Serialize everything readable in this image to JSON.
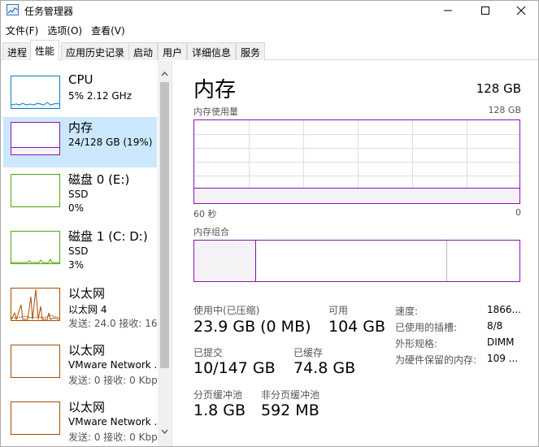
{
  "window": {
    "title": "任务管理器",
    "minimize_glyph": "—",
    "maximize_glyph": "☐",
    "close_glyph": "✕"
  },
  "menu": [
    {
      "label": "文件(F)"
    },
    {
      "label": "选项(O)"
    },
    {
      "label": "查看(V)"
    }
  ],
  "tabs": [
    {
      "label": "进程"
    },
    {
      "label": "性能"
    },
    {
      "label": "应用历史记录"
    },
    {
      "label": "启动"
    },
    {
      "label": "用户"
    },
    {
      "label": "详细信息"
    },
    {
      "label": "服务"
    }
  ],
  "active_tab": "性能",
  "sidebar": {
    "items": [
      {
        "title": "CPU",
        "line1": "5% 2.12 GHz",
        "line2": "",
        "line3": ""
      },
      {
        "title": "内存",
        "line1": "24/128 GB (19%)",
        "line2": "",
        "line3": ""
      },
      {
        "title": "磁盘 0 (E:)",
        "line1": "SSD",
        "line2": "0%",
        "line3": ""
      },
      {
        "title": "磁盘 1 (C: D:)",
        "line1": "SSD",
        "line2": "3%",
        "line3": ""
      },
      {
        "title": "以太网",
        "line1": "以太网 4",
        "line2": "发送: 24.0  接收: 16.",
        "line3": ""
      },
      {
        "title": "以太网",
        "line1": "VMware Network ...",
        "line2": "发送: 0  接收: 0 Kbp",
        "line3": ""
      },
      {
        "title": "以太网",
        "line1": "VMware Network ...",
        "line2": "发送: 0  接收: 0 Kbp",
        "line3": ""
      }
    ]
  },
  "memory": {
    "title": "内存",
    "total": "128 GB",
    "usage_label": "内存使用量",
    "usage_max": "128 GB",
    "usage_fraction": 0.19,
    "axis_left": "60 秒",
    "axis_right": "0",
    "composition_label": "内存组合",
    "stats": {
      "in_use_label": "使用中(已压缩)",
      "in_use_value": "23.9 GB (0 MB)",
      "available_label": "可用",
      "available_value": "104 GB",
      "committed_label": "已提交",
      "committed_value": "10/147 GB",
      "cached_label": "已缓存",
      "cached_value": "74.8 GB",
      "paged_label": "分页缓冲池",
      "paged_value": "1.8 GB",
      "nonpaged_label": "非分页缓冲池",
      "nonpaged_value": "592 MB"
    },
    "details": [
      {
        "label": "速度:",
        "value": "1866..."
      },
      {
        "label": "已使用的插槽:",
        "value": "8/8"
      },
      {
        "label": "外形规格:",
        "value": "DIMM"
      },
      {
        "label": "为硬件保留的内存:",
        "value": "109 ..."
      }
    ]
  },
  "colors": {
    "memory_accent": "#8b12ae",
    "cpu_accent": "#117dbb",
    "disk_accent": "#4da60c",
    "ethernet_accent": "#a74f01",
    "selected_bg": "#cce8ff"
  }
}
